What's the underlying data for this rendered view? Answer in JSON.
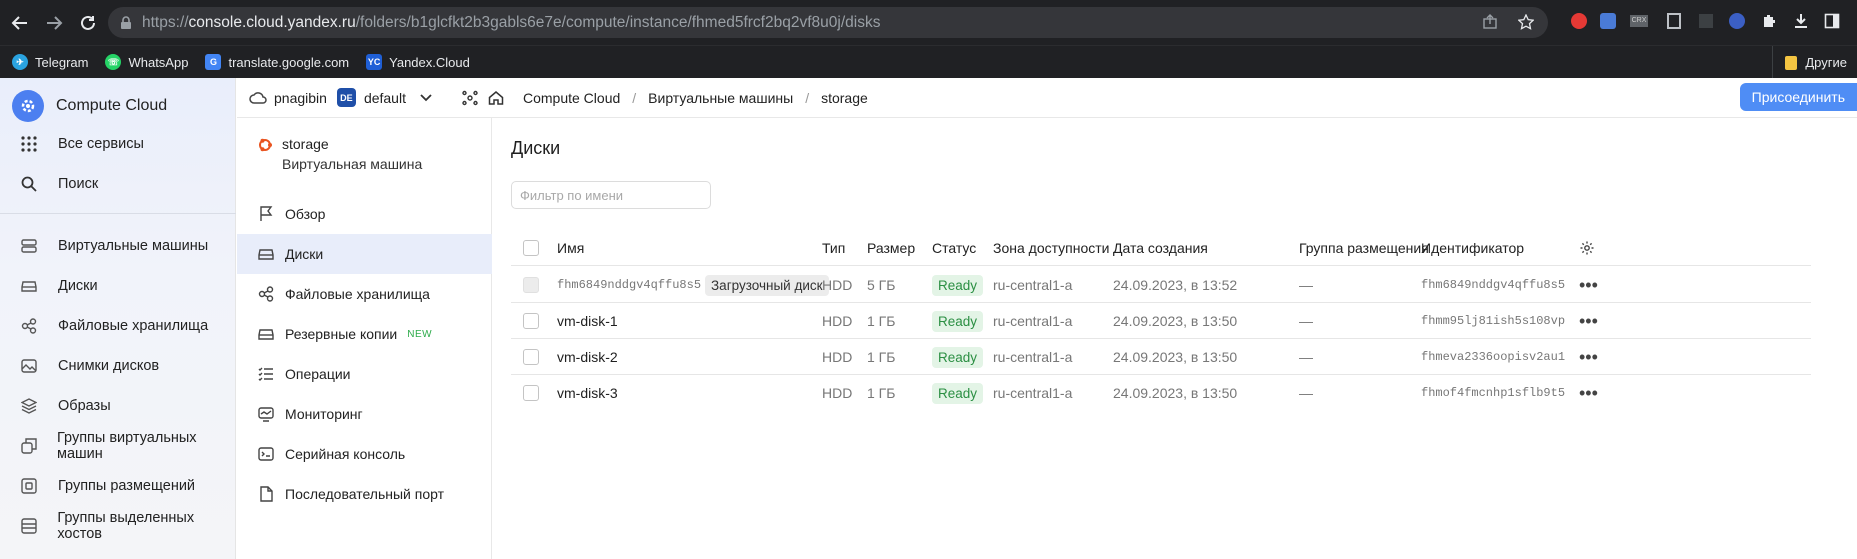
{
  "browser": {
    "url_scheme": "https://",
    "url_host": "console.cloud.yandex.ru",
    "url_path": "/folders/b1glcfkt2b3gabls6e7e/compute/instance/fhmed5frcf2bq2vf8u0j/disks",
    "bookmarks": [
      {
        "label": "Telegram",
        "icon": "telegram-icon",
        "color": "#2aa3e0"
      },
      {
        "label": "WhatsApp",
        "icon": "whatsapp-icon",
        "color": "#25d366"
      },
      {
        "label": "translate.google.com",
        "icon": "google-translate-icon",
        "color": "#4285f4"
      },
      {
        "label": "Yandex.Cloud",
        "icon": "yandex-cloud-icon",
        "color": "#1f5fd6"
      }
    ],
    "other_bookmarks": "Другие"
  },
  "left_nav": {
    "brand": "Compute Cloud",
    "all_services": "Все сервисы",
    "search": "Поиск",
    "items": [
      {
        "label": "Виртуальные машины",
        "icon": "vm-icon"
      },
      {
        "label": "Диски",
        "icon": "disk-icon"
      },
      {
        "label": "Файловые хранилища",
        "icon": "file-storage-icon"
      },
      {
        "label": "Снимки дисков",
        "icon": "snapshot-icon"
      },
      {
        "label": "Образы",
        "icon": "image-icon"
      },
      {
        "label": "Группы виртуальных машин",
        "icon": "instance-group-icon"
      },
      {
        "label": "Группы размещений",
        "icon": "placement-group-icon"
      },
      {
        "label": "Группы выделенных хостов",
        "icon": "host-group-icon"
      }
    ]
  },
  "topbar": {
    "cloud": "pnagibin",
    "folder_badge": "DE",
    "folder": "default",
    "breadcrumbs": [
      "Compute Cloud",
      "Виртуальные машины",
      "storage"
    ],
    "connect_button": "Присоединить"
  },
  "resource_nav": {
    "name": "storage",
    "type": "Виртуальная машина",
    "items": [
      {
        "label": "Обзор",
        "icon": "overview-icon"
      },
      {
        "label": "Диски",
        "icon": "disk-icon",
        "active": true
      },
      {
        "label": "Файловые хранилища",
        "icon": "file-storage-icon"
      },
      {
        "label": "Резервные копии",
        "icon": "backup-icon",
        "badge": "NEW"
      },
      {
        "label": "Операции",
        "icon": "operations-icon"
      },
      {
        "label": "Мониторинг",
        "icon": "monitoring-icon"
      },
      {
        "label": "Серийная консоль",
        "icon": "console-icon"
      },
      {
        "label": "Последовательный порт",
        "icon": "serial-port-icon"
      }
    ]
  },
  "main": {
    "title": "Диски",
    "filter_placeholder": "Фильтр по имени",
    "columns": [
      "Имя",
      "Тип",
      "Размер",
      "Статус",
      "Зона доступности",
      "Дата создания",
      "Группа размещения",
      "Идентификатор"
    ],
    "rows": [
      {
        "name": "fhm6849nddgv4qffu8s5",
        "boot": "Загрузочный диск",
        "type": "HDD",
        "size": "5 ГБ",
        "status": "Ready",
        "zone": "ru-central1-a",
        "created": "24.09.2023, в 13:52",
        "group": "—",
        "id": "fhm6849nddgv4qffu8s5"
      },
      {
        "name": "vm-disk-1",
        "boot": "",
        "type": "HDD",
        "size": "1 ГБ",
        "status": "Ready",
        "zone": "ru-central1-a",
        "created": "24.09.2023, в 13:50",
        "group": "—",
        "id": "fhmm95lj81ish5s108vp"
      },
      {
        "name": "vm-disk-2",
        "boot": "",
        "type": "HDD",
        "size": "1 ГБ",
        "status": "Ready",
        "zone": "ru-central1-a",
        "created": "24.09.2023, в 13:50",
        "group": "—",
        "id": "fhmeva2336oopisv2au1"
      },
      {
        "name": "vm-disk-3",
        "boot": "",
        "type": "HDD",
        "size": "1 ГБ",
        "status": "Ready",
        "zone": "ru-central1-a",
        "created": "24.09.2023, в 13:50",
        "group": "—",
        "id": "fhmof4fmcnhp1sflb9t5"
      }
    ]
  },
  "colors": {
    "accent": "#4f8df5",
    "status_ready_bg": "#e3f4e6",
    "status_ready_text": "#2b8f43",
    "active_nav": "#e8edfa"
  }
}
